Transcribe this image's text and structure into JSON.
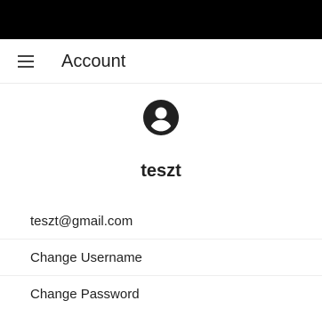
{
  "app_bar": {
    "menu_icon": "hamburger-menu-icon",
    "title": "Account"
  },
  "profile": {
    "avatar_icon": "account-circle-icon",
    "username": "teszt"
  },
  "account_items": [
    {
      "label": "teszt@gmail.com"
    },
    {
      "label": "Change Username"
    },
    {
      "label": "Change Password"
    }
  ],
  "colors": {
    "status_bar": "#000000",
    "background": "#ffffff",
    "text": "#212121",
    "divider": "#eeeeee"
  }
}
